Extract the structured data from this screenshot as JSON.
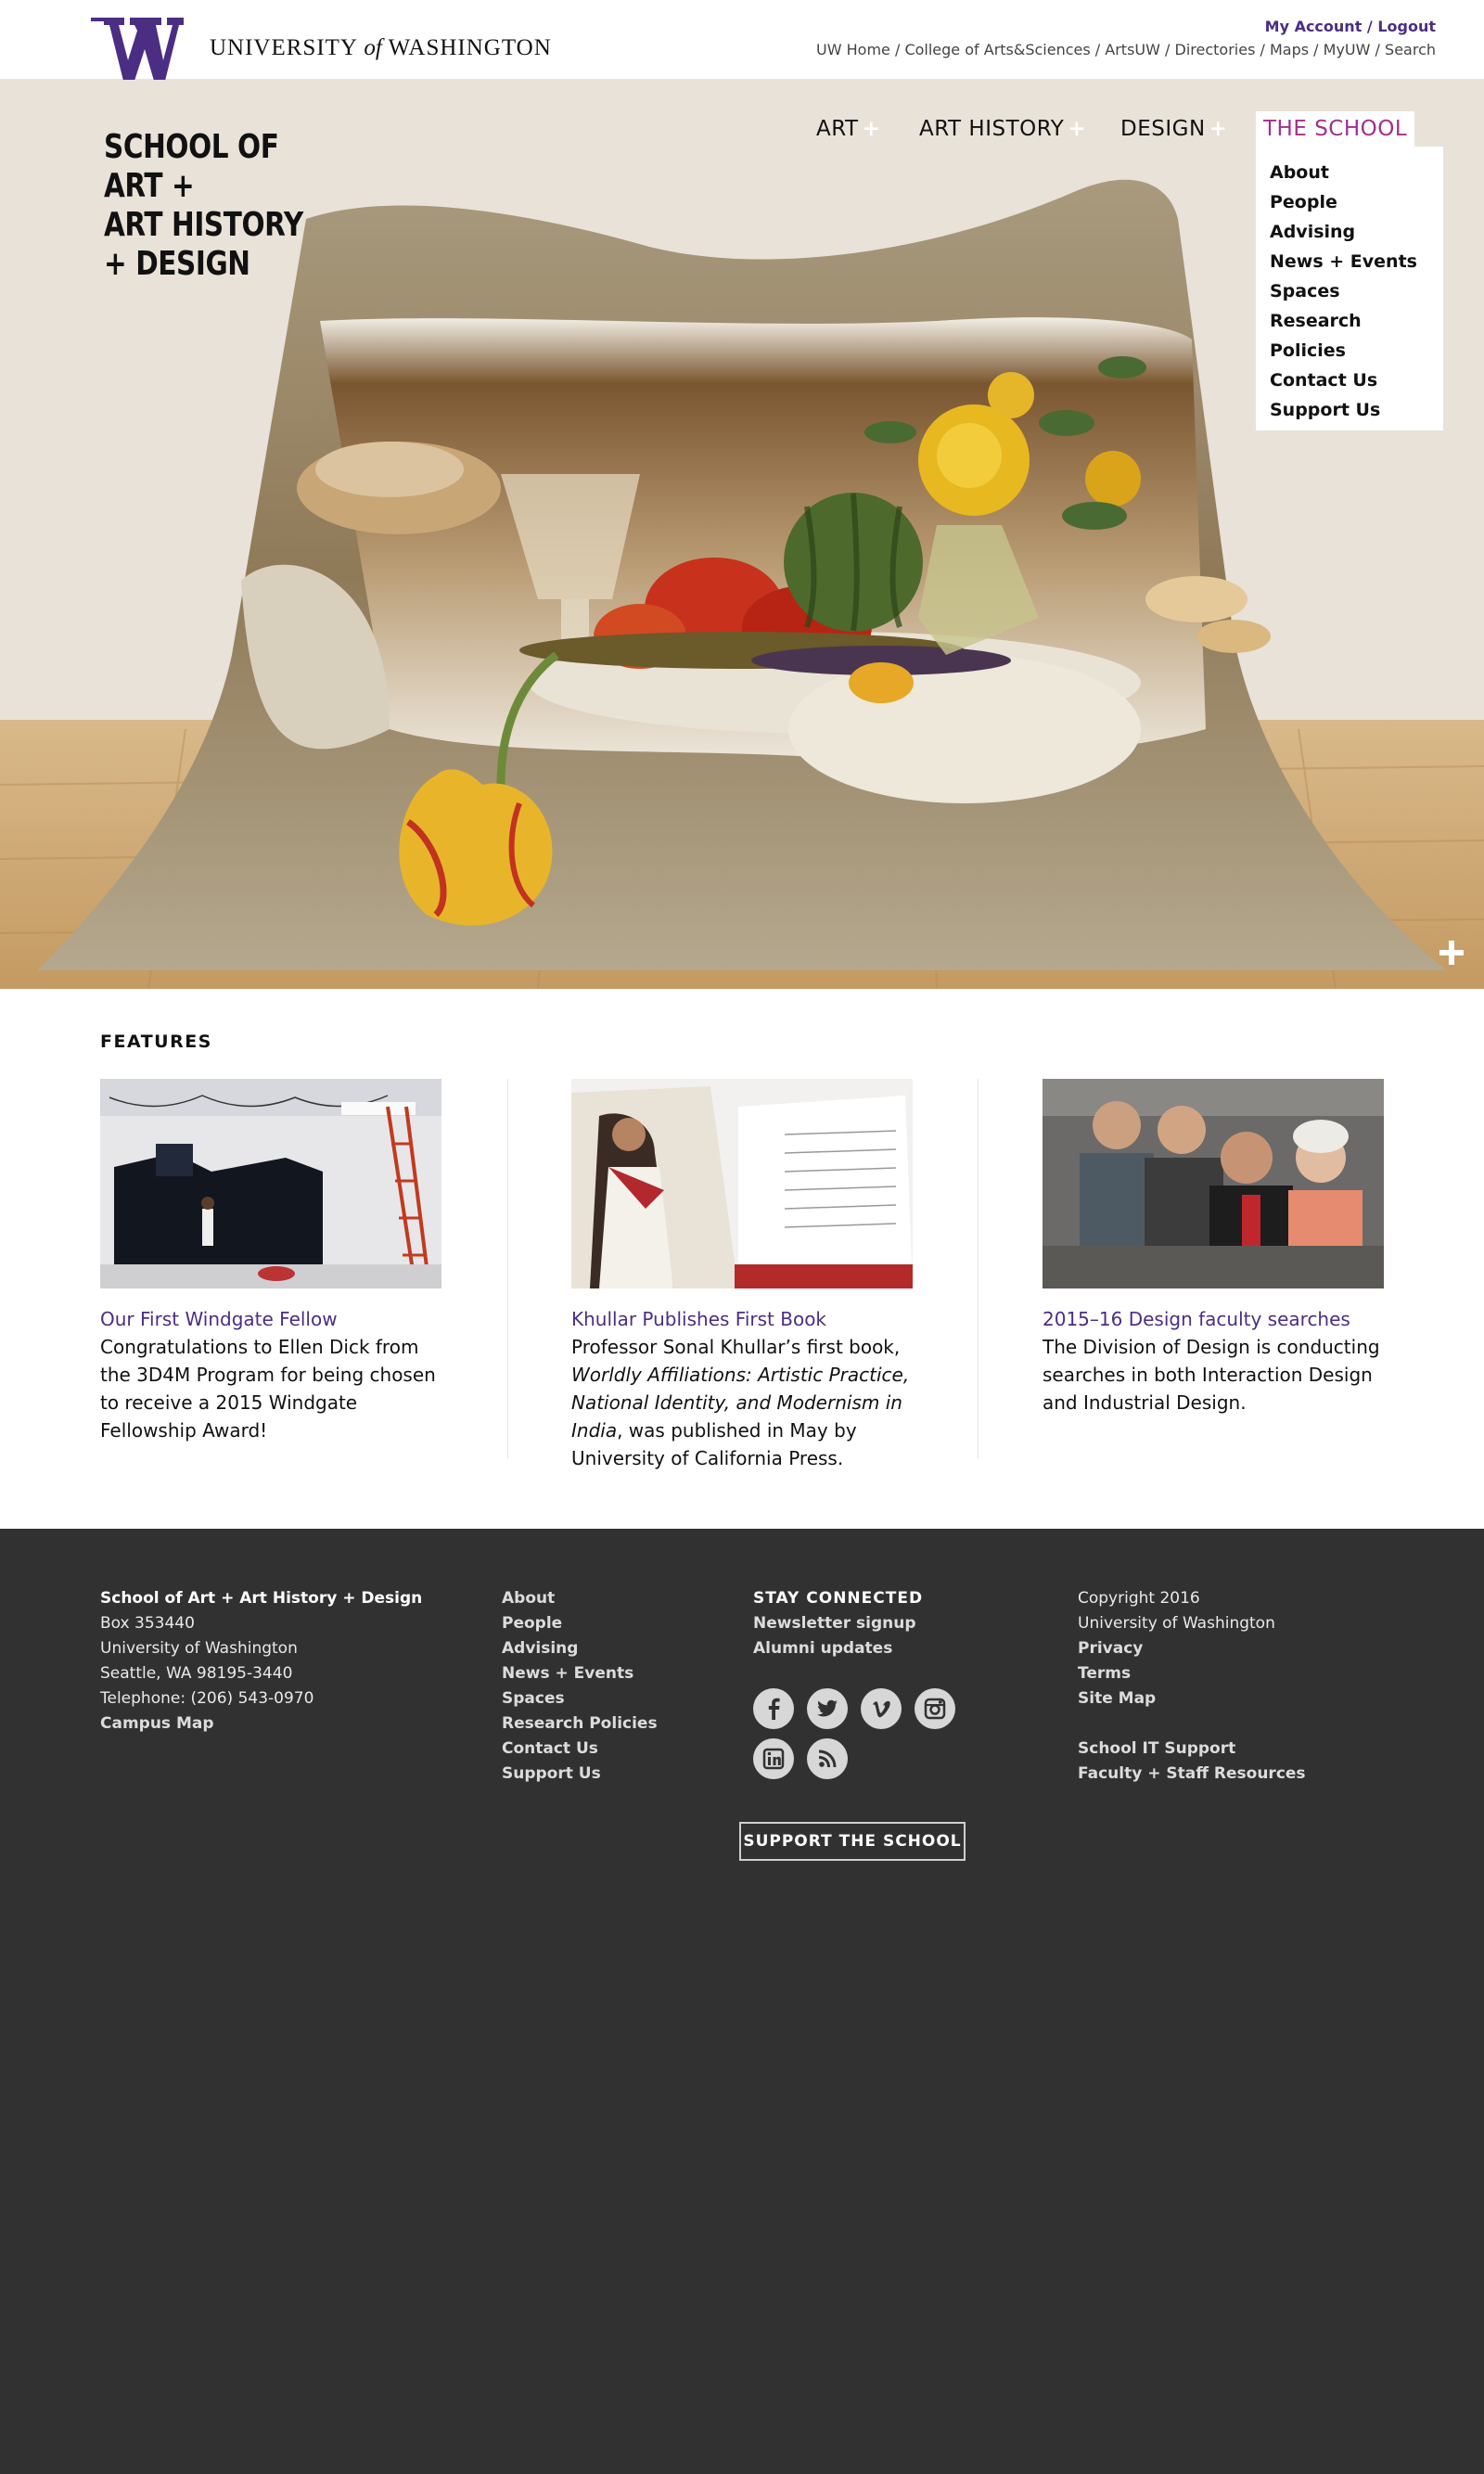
{
  "uw_header": {
    "wordmark_pre": "UNIVERSITY",
    "wordmark_of": "of",
    "wordmark_post": "WASHINGTON",
    "account": {
      "my_account": "My Account",
      "sep": " / ",
      "logout": "Logout"
    },
    "links": [
      "UW Home",
      "College of Arts&Sciences",
      "ArtsUW",
      "Directories",
      "Maps",
      "MyUW",
      "Search"
    ],
    "link_sep": " / ",
    "brand_purple": "#4b2e83"
  },
  "hero": {
    "school_title_lines": [
      "SCHOOL OF",
      "ART +",
      "ART HISTORY",
      "+ DESIGN"
    ],
    "nav": {
      "art": "ART",
      "art_history": "ART HISTORY",
      "design": "DESIGN",
      "the_school": "THE SCHOOL",
      "plus": "+",
      "active_color": "#a32e8f"
    },
    "school_menu": [
      "About",
      "People",
      "Advising",
      "News + Events",
      "Spaces",
      "Research",
      "Policies",
      "Contact Us",
      "Support Us"
    ],
    "expand_icon": "plus-icon"
  },
  "features": {
    "heading": "FEATURES",
    "items": [
      {
        "title": "Our First Windgate Fellow",
        "body": "Congratulations to Ellen Dick from the 3D4M Program for being chosen to receive a 2015 Windgate Fellowship Award!"
      },
      {
        "title": "Khullar Publishes First Book",
        "body_pre": "Professor Sonal Khullar’s first book, ",
        "body_em": "Worldly Affiliations: Artistic Practice, National Identity, and Modernism in India",
        "body_post": ", was published in May by University of California Press."
      },
      {
        "title": "2015–16 Design faculty searches",
        "body": "The Division of Design is conducting searches in both Interaction Design and Industrial Design."
      }
    ]
  },
  "footer": {
    "address": {
      "name": "School of Art + Art History + Design",
      "lines": [
        "Box 353440",
        "University of Washington",
        "Seattle, WA 98195-3440",
        "Telephone: (206) 543-0970"
      ],
      "map_link": "Campus Map"
    },
    "links": [
      "About",
      "People",
      "Advising",
      "News + Events",
      "Spaces",
      "Research Policies",
      "Contact Us",
      "Support Us"
    ],
    "connect": {
      "heading": "STAY CONNECTED",
      "links": [
        "Newsletter signup",
        "Alumni updates"
      ],
      "social_icons": [
        "facebook-icon",
        "twitter-icon",
        "vimeo-icon",
        "instagram-icon",
        "linkedin-icon",
        "rss-icon"
      ]
    },
    "legal": {
      "lines": [
        "Copyright 2016",
        "University of Washington"
      ],
      "links": [
        "Privacy",
        "Terms",
        "Site Map"
      ],
      "links2": [
        "School IT Support",
        "Faculty + Staff Resources"
      ]
    },
    "support_button": "SUPPORT THE SCHOOL",
    "background": "#313131"
  }
}
